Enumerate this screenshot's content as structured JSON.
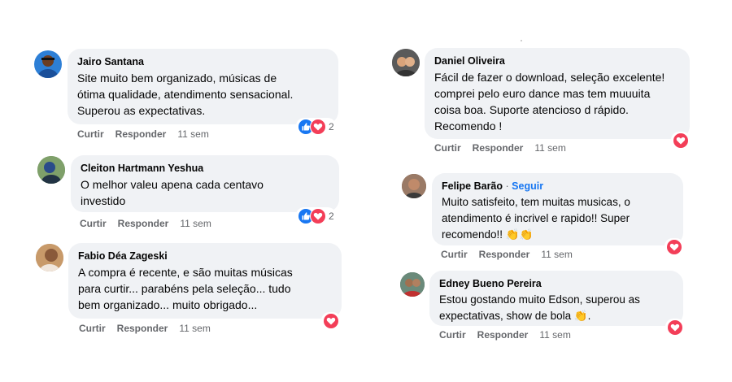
{
  "actions": {
    "like": "Curtir",
    "reply": "Responder"
  },
  "comments": [
    {
      "name": "Jairo Santana",
      "text": [
        "Site muito bem organizado, músicas de",
        "ótima qualidade, atendimento sensacional.",
        "Superou as expectativas."
      ],
      "time": "11 sem",
      "reaction_count": "2"
    },
    {
      "name": "Cleiton Hartmann Yeshua",
      "text": [
        "O melhor valeu apena cada centavo",
        "investido"
      ],
      "time": "11 sem",
      "reaction_count": "2"
    },
    {
      "name": "Fabio Déa Zageski",
      "text": [
        "A compra é recente, e são muitas músicas",
        "para curtir... parabéns pela seleção... tudo",
        "bem organizado... muito obrigado..."
      ],
      "time": "11 sem"
    },
    {
      "name": "Daniel Oliveira",
      "text": [
        "Fácil de fazer o download, seleção excelente!",
        "comprei pelo euro dance mas tem muuuita",
        "coisa boa. Suporte atencioso d rápido.",
        "Recomendo !"
      ],
      "time": "11 sem"
    },
    {
      "name": "Felipe Barão",
      "separator": "·",
      "follow": "Seguir",
      "text": [
        "Muito satisfeito, tem muitas musicas, o",
        "atendimento é incrivel e rapido!! Super",
        "recomendo!! 👏👏"
      ],
      "time": "11 sem"
    },
    {
      "name": "Edney Bueno Pereira",
      "text": [
        "Estou gostando muito Edson, superou as",
        "expectativas, show de bola 👏."
      ],
      "time": "11 sem"
    }
  ],
  "colors": {
    "bubble": "#f0f2f5",
    "like": "#1877f2",
    "love": "#f33e58",
    "meta": "#65676b",
    "follow": "#1877f2"
  }
}
